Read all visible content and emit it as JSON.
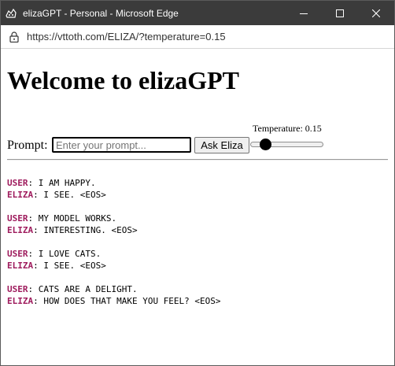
{
  "window": {
    "title": "elizaGPT - Personal - Microsoft Edge"
  },
  "browser": {
    "url": "https://vttoth.com/ELIZA/?temperature=0.15"
  },
  "page": {
    "heading": "Welcome to elizaGPT",
    "prompt_label": "Prompt:",
    "prompt_placeholder": "Enter your prompt...",
    "prompt_value": "",
    "ask_button": "Ask Eliza",
    "temperature_label": "Temperature: 0.15",
    "temperature": {
      "value": 0.15,
      "min": 0,
      "max": 1
    }
  },
  "conversation": [
    {
      "user_label": "USER",
      "user_text": ": I AM HAPPY.",
      "eliza_label": "ELIZA",
      "eliza_text": ": I SEE. <EOS>"
    },
    {
      "user_label": "USER",
      "user_text": ": MY MODEL WORKS.",
      "eliza_label": "ELIZA",
      "eliza_text": ": INTERESTING. <EOS>"
    },
    {
      "user_label": "USER",
      "user_text": ": I LOVE CATS.",
      "eliza_label": "ELIZA",
      "eliza_text": ": I SEE. <EOS>"
    },
    {
      "user_label": "USER",
      "user_text": ": CATS ARE A DELIGHT.",
      "eliza_label": "ELIZA",
      "eliza_text": ": HOW DOES THAT MAKE YOU FEEL? <EOS>"
    }
  ],
  "colors": {
    "titlebar": "#3b3b3b",
    "speaker": "#9e1a5c"
  }
}
